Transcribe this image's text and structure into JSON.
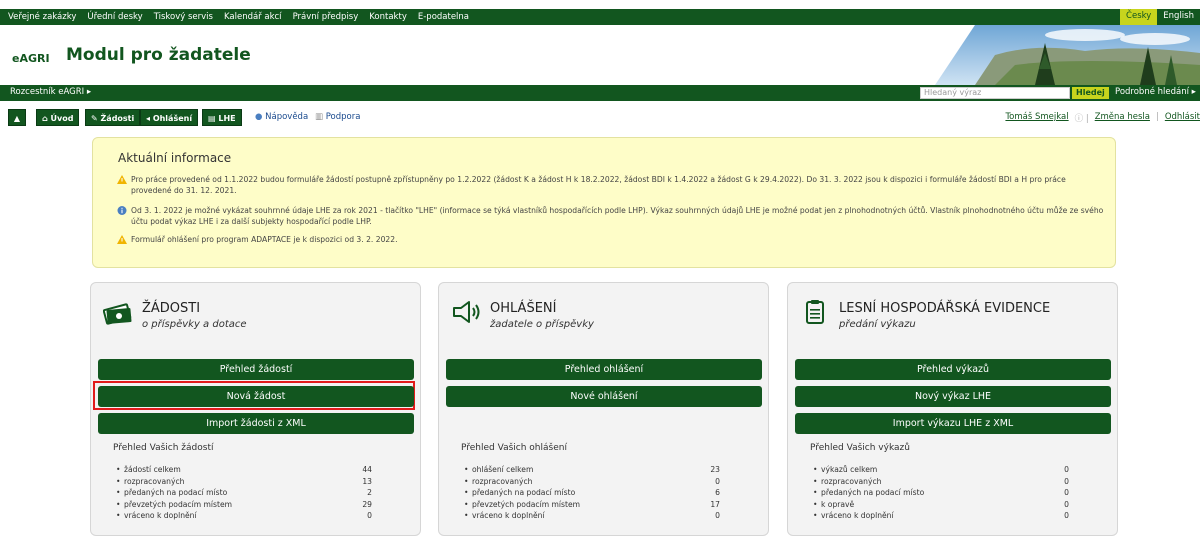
{
  "topbar": {
    "links": [
      "Veřejné zakázky",
      "Úřední desky",
      "Tiskový servis",
      "Kalendář akcí",
      "Právní předpisy",
      "Kontakty",
      "E-podatelna"
    ],
    "lang_active": "Česky",
    "lang_other": "English"
  },
  "header": {
    "brand": "eAGRI",
    "title": "Modul pro žadatele"
  },
  "bar2": {
    "rozcestnik": "Rozcestník eAGRI ▸",
    "search_placeholder": "Hledaný výraz",
    "search_button": "Hledej",
    "advanced": "Podrobné hledání ▸"
  },
  "nav": {
    "up": "▲",
    "uvod": "Úvod",
    "zadosti": "Žádosti",
    "ohlaseni": "Ohlášení",
    "lhe": "LHE",
    "napoveda": "Nápověda",
    "podpora": "Podpora",
    "user": "Tomáš Smejkal",
    "change_pwd": "Změna hesla",
    "logout": "Odhlásit"
  },
  "info": {
    "title": "Aktuální informace",
    "items": [
      "Pro práce provedené od 1.1.2022 budou formuláře žádostí postupně zpřístupněny po 1.2.2022 (žádost K a žádost H k 18.2.2022, žádost BDI k 1.4.2022 a žádost G k 29.4.2022). Do 31. 3. 2022 jsou k dispozici i formuláře žádostí BDI a H pro práce provedené do 31. 12. 2021.",
      "Od 3. 1. 2022 je možné vykázat souhrnné údaje LHE za rok 2021 - tlačítko \"LHE\" (informace se týká vlastníků hospodařících podle LHP). Výkaz souhrnných údajů LHE je možné podat jen z plnohodnotných účtů. Vlastník plnohodnotného účtu může ze svého účtu podat výkaz LHE i za další subjekty hospodařící podle LHP.",
      "Formulář ohlášení pro program ADAPTACE je k dispozici od 3. 2. 2022."
    ]
  },
  "cards": [
    {
      "title": "ŽÁDOSTI",
      "subtitle": "o příspěvky a dotace",
      "buttons": [
        "Přehled žádostí",
        "Nová žádost",
        "Import žádosti z XML"
      ],
      "stats_title": "Přehled Vašich žádostí",
      "stats": [
        {
          "label": "žádostí celkem",
          "value": "44"
        },
        {
          "label": "rozpracovaných",
          "value": "13"
        },
        {
          "label": "předaných na podací místo",
          "value": "2"
        },
        {
          "label": "převzetých podacím místem",
          "value": "29"
        },
        {
          "label": "vráceno k doplnění",
          "value": "0"
        }
      ]
    },
    {
      "title": "OHLÁŠENÍ",
      "subtitle": "žadatele o příspěvky",
      "buttons": [
        "Přehled ohlášení",
        "Nové ohlášení"
      ],
      "stats_title": "Přehled Vašich ohlášení",
      "stats": [
        {
          "label": "ohlášení celkem",
          "value": "23"
        },
        {
          "label": "rozpracovaných",
          "value": "0"
        },
        {
          "label": "předaných na podací místo",
          "value": "6"
        },
        {
          "label": "převzetých podacím místem",
          "value": "17"
        },
        {
          "label": "vráceno k doplnění",
          "value": "0"
        }
      ]
    },
    {
      "title": "LESNÍ HOSPODÁŘSKÁ EVIDENCE",
      "subtitle": "předání výkazu",
      "buttons": [
        "Přehled výkazů",
        "Nový výkaz LHE",
        "Import výkazu LHE z XML"
      ],
      "stats_title": "Přehled Vašich výkazů",
      "stats": [
        {
          "label": "výkazů celkem",
          "value": "0"
        },
        {
          "label": "rozpracovaných",
          "value": "0"
        },
        {
          "label": "předaných na podací místo",
          "value": "0"
        },
        {
          "label": "k opravě",
          "value": "0"
        },
        {
          "label": "vráceno k doplnění",
          "value": "0"
        }
      ]
    }
  ],
  "colors": {
    "brand_green": "#12561f",
    "accent_lime": "#c7d41d",
    "info_bg": "#fefdc8",
    "highlight": "#e21b1b"
  }
}
